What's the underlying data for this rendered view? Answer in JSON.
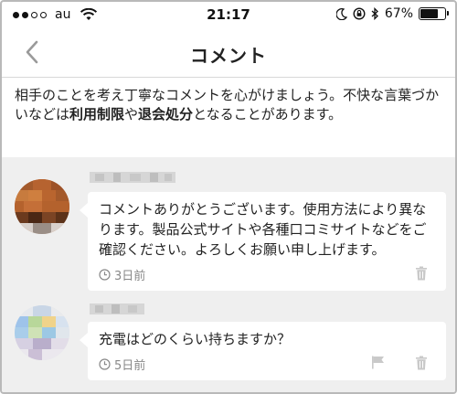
{
  "status_bar": {
    "carrier": "au",
    "time": "21:17",
    "battery": "67%",
    "battery_level": 0.67,
    "signal_bars_filled": 2,
    "icons": [
      "wifi-icon",
      "moon-icon",
      "rotation-lock-icon",
      "bluetooth-icon",
      "battery-icon"
    ]
  },
  "nav": {
    "title": "コメント",
    "back_icon": "chevron-left-icon"
  },
  "notice": {
    "text_a": "相手のことを考え丁寧なコメントを心がけましょう。不快な言葉づかいなどは",
    "bold_a": "利用制限",
    "text_b": "や",
    "bold_b": "退会処分",
    "text_c": "となることがあります。"
  },
  "comments": [
    {
      "body": "コメントありがとうございます。使用方法により異なります。製品公式サイトや各種口コミサイトなどをご確認ください。よろしくお願い申し上げます。",
      "age": "3日前",
      "actions": [
        "trash-icon"
      ]
    },
    {
      "body": "充電はどのくらい持ちますか？",
      "age": "5日前",
      "actions": [
        "flag-icon",
        "trash-icon"
      ]
    }
  ],
  "colors": {
    "list_background": "#efefef",
    "meta_gray": "#888888",
    "frame_border": "#b9b9b9"
  }
}
